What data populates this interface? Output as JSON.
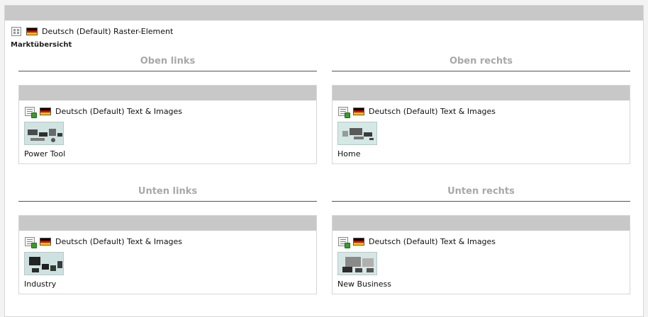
{
  "top": {
    "lang_label": "Deutsch (Default) Raster-Element",
    "element_title": "Marktübersicht"
  },
  "columns": [
    {
      "header": "Oben links",
      "lang_label": "Deutsch (Default) Text & Images",
      "image_caption": "Power Tool"
    },
    {
      "header": "Oben rechts",
      "lang_label": "Deutsch (Default) Text & Images",
      "image_caption": "Home"
    },
    {
      "header": "Unten links",
      "lang_label": "Deutsch (Default) Text & Images",
      "image_caption": "Industry"
    },
    {
      "header": "Unten rechts",
      "lang_label": "Deutsch (Default) Text & Images",
      "image_caption": "New Business"
    }
  ],
  "icons": {
    "element": "page-grid-icon",
    "content": "page-text-image-icon",
    "language": "flag-de-icon"
  },
  "colors": {
    "header_bar": "#c8c8c8",
    "column_heading": "#a8a8a8",
    "border": "#d6d6d6"
  }
}
